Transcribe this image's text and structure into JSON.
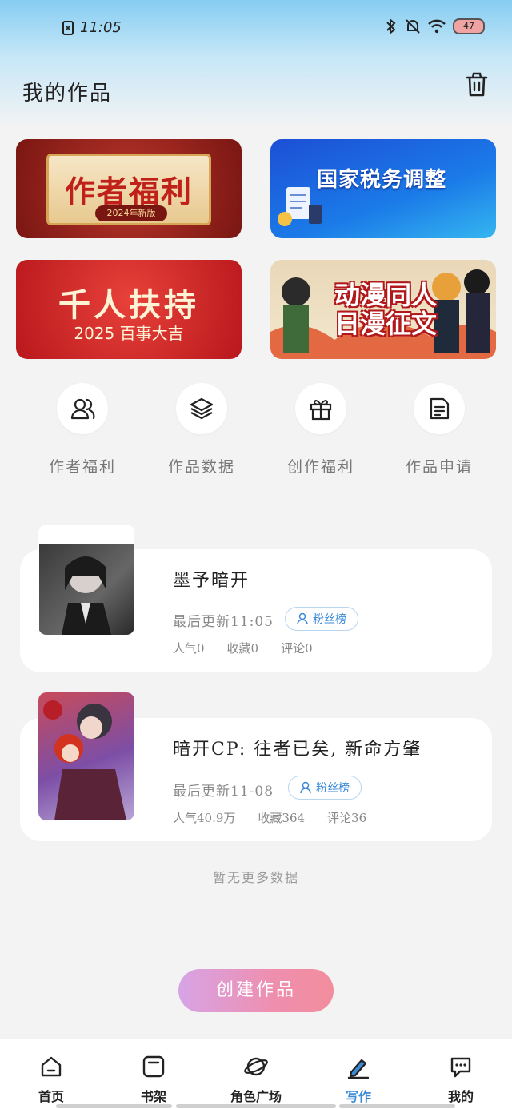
{
  "status_bar": {
    "time": "11:05",
    "battery_level": "47"
  },
  "header": {
    "title": "我的作品"
  },
  "banners": [
    {
      "title": "作者福利",
      "subtitle": "2024年新版"
    },
    {
      "title": "国家税务调整"
    },
    {
      "title": "千人扶持",
      "subtitle": "2025 百事大吉"
    },
    {
      "title": "动漫同人 日漫征文"
    }
  ],
  "quick_actions": [
    {
      "label": "作者福利",
      "icon": "users-icon"
    },
    {
      "label": "作品数据",
      "icon": "layers-icon"
    },
    {
      "label": "创作福利",
      "icon": "gift-icon"
    },
    {
      "label": "作品申请",
      "icon": "document-icon"
    }
  ],
  "works": [
    {
      "title": "墨予暗开",
      "last_update": "最后更新11:05",
      "fans_label": "粉丝榜",
      "popularity": "人气0",
      "favorites": "收藏0",
      "comments": "评论0"
    },
    {
      "title": "暗开CP: 往者已矣, 新命方肇",
      "last_update": "最后更新11-08",
      "fans_label": "粉丝榜",
      "popularity": "人气40.9万",
      "favorites": "收藏364",
      "comments": "评论36"
    }
  ],
  "no_more_text": "暂无更多数据",
  "create_button": "创建作品",
  "tabbar": [
    {
      "label": "首页",
      "icon": "home-icon",
      "active": false
    },
    {
      "label": "书架",
      "icon": "bookshelf-icon",
      "active": false
    },
    {
      "label": "角色广场",
      "icon": "planet-icon",
      "active": false
    },
    {
      "label": "写作",
      "icon": "pen-icon",
      "active": true
    },
    {
      "label": "我的",
      "icon": "chat-icon",
      "active": false
    }
  ],
  "colors": {
    "accent": "#3a8ad8",
    "create_gradient_start": "#d7a4e6",
    "create_gradient_end": "#f38d9d"
  }
}
